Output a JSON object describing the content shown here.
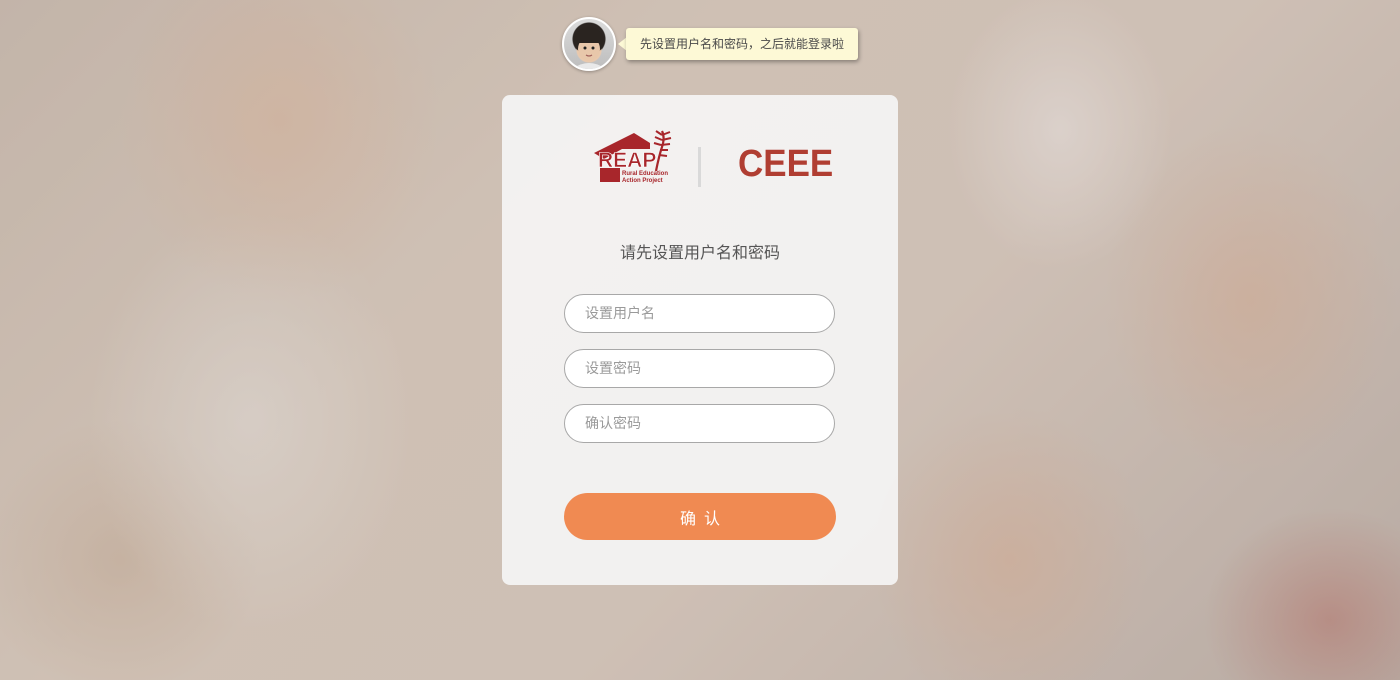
{
  "tooltip": {
    "text": "先设置用户名和密码，之后就能登录啦"
  },
  "logos": {
    "reap_main": "REAP",
    "reap_sub_line1": "Rural Education",
    "reap_sub_line2": "Action Project",
    "ceee": "CEEE"
  },
  "form": {
    "heading": "请先设置用户名和密码",
    "username_placeholder": "设置用户名",
    "username_value": "",
    "password_placeholder": "设置密码",
    "password_value": "",
    "confirm_password_placeholder": "确认密码",
    "confirm_password_value": "",
    "confirm_label": "确认"
  },
  "colors": {
    "accent": "#f08a52",
    "brand_red": "#b03e32",
    "tooltip_bg": "#fdf9d6"
  },
  "icons": {
    "avatar": "child-avatar-icon",
    "reap_logo": "reap-house-wheat-logo"
  }
}
